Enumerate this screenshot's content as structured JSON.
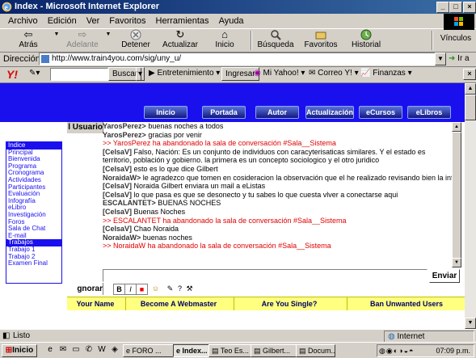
{
  "window": {
    "title": "Index - Microsoft Internet Explorer",
    "min": "_",
    "max": "□",
    "close": "×"
  },
  "menu": [
    "Archivo",
    "Edición",
    "Ver",
    "Favoritos",
    "Herramientas",
    "Ayuda"
  ],
  "toolbar": {
    "back": "Atrás",
    "forward": "Adelante",
    "stop": "Detener",
    "refresh": "Actualizar",
    "home": "Inicio",
    "search": "Búsqueda",
    "favorites": "Favoritos",
    "history": "Historial",
    "links": "Vínculos"
  },
  "address": {
    "label": "Dirección",
    "url": "http://www.train4you.com/sig/uny_u/",
    "go": "Ir a"
  },
  "yahoo": {
    "logo": "Y!",
    "search_btn": "Buscar",
    "entertainment": "Entretenimiento",
    "login": "Ingresar",
    "my_yahoo": "Mi Yahoo!",
    "mail": "Correo Y!",
    "finance": "Finanzas"
  },
  "site_nav": [
    "Inicio",
    "Portada",
    "Autor",
    "Actualización",
    "eCursos",
    "eLibros"
  ],
  "left_nav": {
    "items": [
      "Indice",
      "Principal",
      "Bienvenida",
      "Programa",
      "Cronograma",
      "Actividades",
      "Participantes",
      "Evaluación",
      "Infografía",
      "eLibro",
      "Investigación",
      "Foros",
      "Sala de Chat",
      "E-mail",
      "Trabajos",
      "Trabajo 1",
      "Trabajo 2",
      "Examen Final"
    ],
    "selected": [
      0,
      14
    ]
  },
  "chat": {
    "users_label": "l Usuario",
    "messages": [
      {
        "nick": "YarosPerez>",
        "text": "buenas noches a todos",
        "type": "user"
      },
      {
        "nick": "YarosPerez>",
        "text": "gracias por venir",
        "type": "user"
      },
      {
        "nick": "",
        "text": ">> YarosPerez ha abandonado la sala de conversación #Sala__Sistema",
        "type": "system"
      },
      {
        "nick": "[CelsaV]",
        "text": "Falso, Nación: Es un conjunto de individuos con caracyterisaticas similares. Y el estado es territorio, población y gobierno. la primera es un concepto sociologico y el otro juridico",
        "type": "user-wrap"
      },
      {
        "nick": "[CelsaV]",
        "text": "esto es lo que dice Gilbert",
        "type": "user"
      },
      {
        "nick": "NoraidaW>",
        "text": "le agradezco que tomen en cosideracion la observación que el he realizado revisando bien la infografia",
        "type": "user"
      },
      {
        "nick": "[CelsaV]",
        "text": "Noraida Gilbert enviara un mail a eListas",
        "type": "user"
      },
      {
        "nick": "[CelsaV]",
        "text": "lo que pasa es que se desonecto y tu sabes lo que cuesta vlver a conectarse aqui",
        "type": "user"
      },
      {
        "nick": "ESCALANTET>",
        "text": "BUENAS NOCHES",
        "type": "user"
      },
      {
        "nick": "[CelsaV]",
        "text": "Buenas Noches",
        "type": "user"
      },
      {
        "nick": "",
        "text": ">> ESCALANTET ha abandonado la sala de conversación #Sala__Sistema",
        "type": "system"
      },
      {
        "nick": "[CelsaV]",
        "text": "Chao Noraida",
        "type": "user"
      },
      {
        "nick": "NoraidaW>",
        "text": "buenas noches",
        "type": "user"
      },
      {
        "nick": "",
        "text": ">> NoraidaW ha abandonado la sala de conversación #Sala__Sistema",
        "type": "system"
      }
    ],
    "send": "Enviar",
    "ignore": "gnorar",
    "format": [
      "B",
      "I",
      "■",
      "☺",
      "✎",
      "?",
      "⚒"
    ]
  },
  "ads": [
    "Your Name",
    "Become A Webmaster",
    "Are You Single?",
    "Ban Unwanted Users"
  ],
  "status": {
    "text": "Listo",
    "zone": "Internet"
  },
  "taskbar": {
    "start": "Inicio",
    "tasks": [
      "FORO ...",
      "Index...",
      "Teo Es...",
      "Gilbert...",
      "Docum..."
    ],
    "clock": "07:09 p.m."
  }
}
